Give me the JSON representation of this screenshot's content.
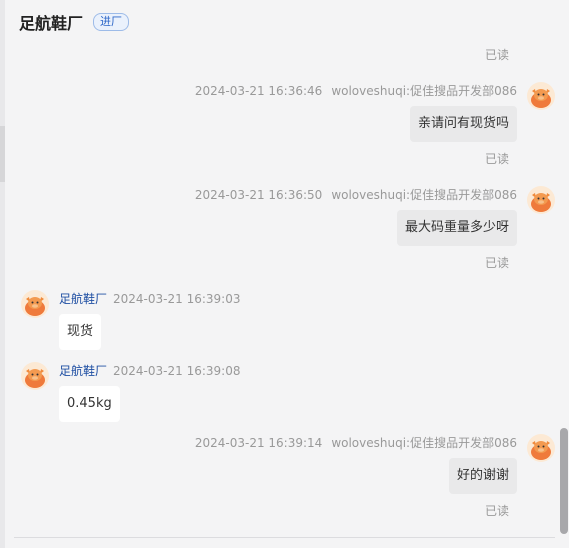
{
  "header": {
    "title": "足航鞋厂",
    "tag": "进厂"
  },
  "messages": {
    "m0": {
      "status": "已读"
    },
    "m1": {
      "time": "2024-03-21 16:36:46",
      "sender": "woloveshuqi:促佳搜品开发部086",
      "text": "亲请问有现货吗",
      "status": "已读"
    },
    "m2": {
      "time": "2024-03-21 16:36:50",
      "sender": "woloveshuqi:促佳搜品开发部086",
      "text": "最大码重量多少呀",
      "status": "已读"
    },
    "m3": {
      "sender": "足航鞋厂",
      "time": "2024-03-21 16:39:03",
      "text": "现货"
    },
    "m4": {
      "sender": "足航鞋厂",
      "time": "2024-03-21 16:39:08",
      "text": "0.45kg"
    },
    "m5": {
      "time": "2024-03-21 16:39:14",
      "sender": "woloveshuqi:促佳搜品开发部086",
      "text": "好的谢谢",
      "status": "已读"
    }
  },
  "icons": {
    "avatar": "cartoon-bull-avatar-icon"
  },
  "colors": {
    "background": "#f4f4f5",
    "outgoing_bubble": "#e9e9ea",
    "incoming_bubble": "#ffffff",
    "sender_name": "#1f4fa3",
    "tag_text": "#2d67c8"
  }
}
